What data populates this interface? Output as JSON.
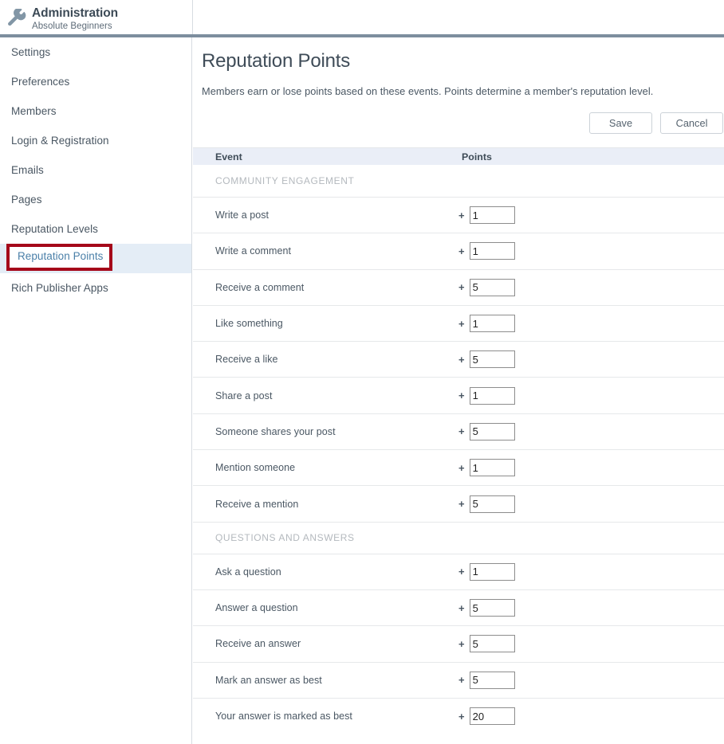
{
  "header": {
    "icon": "wrench-icon",
    "title": "Administration",
    "subtitle": "Absolute Beginners"
  },
  "sidebar": {
    "items": [
      {
        "label": "Settings",
        "active": false
      },
      {
        "label": "Preferences",
        "active": false
      },
      {
        "label": "Members",
        "active": false
      },
      {
        "label": "Login & Registration",
        "active": false
      },
      {
        "label": "Emails",
        "active": false
      },
      {
        "label": "Pages",
        "active": false
      },
      {
        "label": "Reputation Levels",
        "active": false
      },
      {
        "label": "Reputation Points",
        "active": true
      },
      {
        "label": "Rich Publisher Apps",
        "active": false
      }
    ],
    "annotation": {
      "target_label": "Reputation Points",
      "color": "#a5071a"
    }
  },
  "main": {
    "title": "Reputation Points",
    "description": "Members earn or lose points based on these events. Points determine a member's reputation level.",
    "buttons": {
      "save": "Save",
      "cancel": "Cancel"
    },
    "table": {
      "columns": {
        "event": "Event",
        "points": "Points"
      },
      "sections": [
        {
          "name": "COMMUNITY ENGAGEMENT",
          "rows": [
            {
              "event": "Write a post",
              "sign": "+",
              "points": "1"
            },
            {
              "event": "Write a comment",
              "sign": "+",
              "points": "1"
            },
            {
              "event": "Receive a comment",
              "sign": "+",
              "points": "5"
            },
            {
              "event": "Like something",
              "sign": "+",
              "points": "1"
            },
            {
              "event": "Receive a like",
              "sign": "+",
              "points": "5"
            },
            {
              "event": "Share a post",
              "sign": "+",
              "points": "1"
            },
            {
              "event": "Someone shares your post",
              "sign": "+",
              "points": "5"
            },
            {
              "event": "Mention someone",
              "sign": "+",
              "points": "1"
            },
            {
              "event": "Receive a mention",
              "sign": "+",
              "points": "5"
            }
          ]
        },
        {
          "name": "QUESTIONS AND ANSWERS",
          "rows": [
            {
              "event": "Ask a question",
              "sign": "+",
              "points": "1"
            },
            {
              "event": "Answer a question",
              "sign": "+",
              "points": "5"
            },
            {
              "event": "Receive an answer",
              "sign": "+",
              "points": "5"
            },
            {
              "event": "Mark an answer as best",
              "sign": "+",
              "points": "5"
            },
            {
              "event": "Your answer is marked as best",
              "sign": "+",
              "points": "20"
            }
          ]
        }
      ]
    }
  },
  "colors": {
    "header_rule": "#7d8e9e",
    "active_nav_bg": "#e4edf6",
    "active_nav_text": "#4a7fa8",
    "table_head_bg": "#eaeef7",
    "annotation_red": "#a5071a"
  }
}
